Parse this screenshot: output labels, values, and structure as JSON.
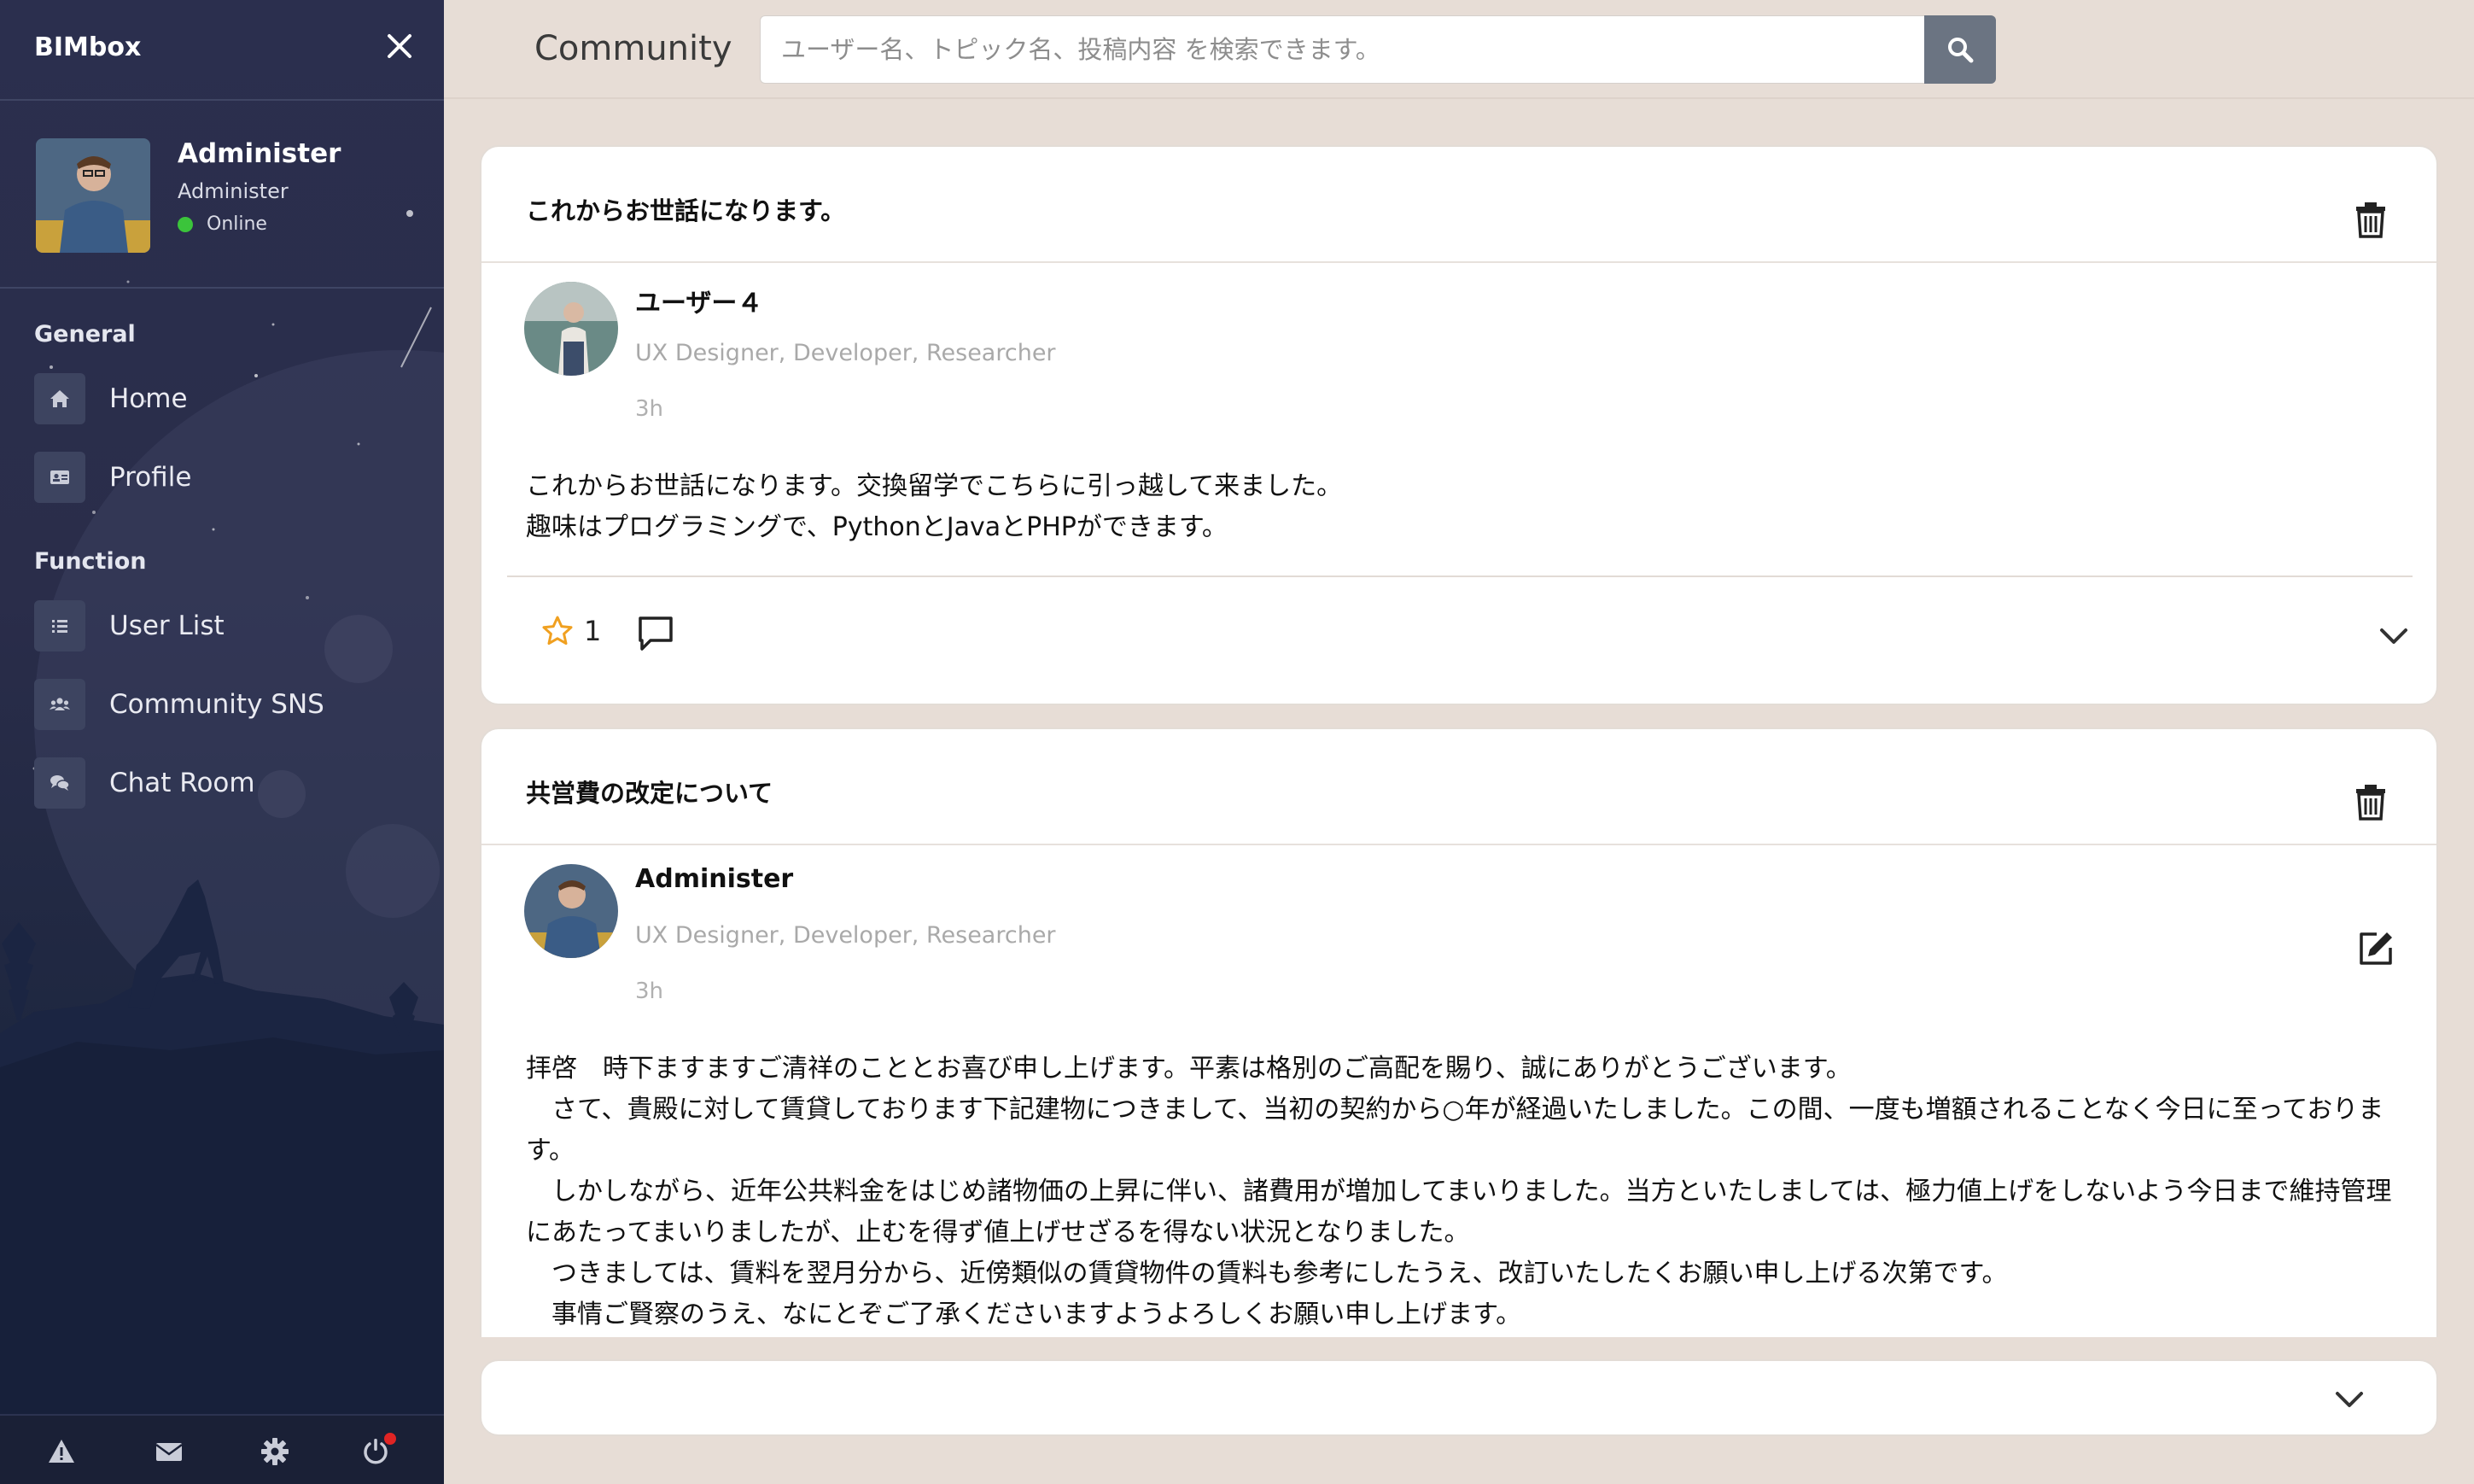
{
  "sidebar": {
    "brand": "BIMbox",
    "user": {
      "name": "Administer",
      "role": "Administer",
      "status": "Online"
    },
    "sections": [
      {
        "title": "General",
        "items": [
          {
            "label": "Home",
            "icon": "home-icon"
          },
          {
            "label": "Profile",
            "icon": "id-card-icon"
          }
        ]
      },
      {
        "title": "Function",
        "items": [
          {
            "label": "User List",
            "icon": "list-icon"
          },
          {
            "label": "Community SNS",
            "icon": "users-icon"
          },
          {
            "label": "Chat Room",
            "icon": "chat-bubbles-icon"
          }
        ]
      }
    ],
    "footer_icons": [
      "warning-icon",
      "envelope-icon",
      "gear-icon",
      "power-icon"
    ]
  },
  "header": {
    "title": "Community",
    "search_placeholder": "ユーザー名、トピック名、投稿内容 を検索できます。"
  },
  "posts": [
    {
      "title": "これからお世話になります。",
      "author": "ユーザー４",
      "role": "UX Designer, Developer, Researcher",
      "time": "3h",
      "body": "これからお世話になります。交換留学でこちらに引っ越して来ました。\n趣味はプログラミングで、PythonとJavaとPHPができます。",
      "stars": "1"
    },
    {
      "title": "共営費の改定について",
      "author": "Administer",
      "role": "UX Designer, Developer, Researcher",
      "time": "3h",
      "body": "拝啓　時下ますますご清祥のこととお喜び申し上げます。平素は格別のご高配を賜り、誠にありがとうございます。\n　さて、貴殿に対して賃貸しております下記建物につきまして、当初の契約から○年が経過いたしました。この間、一度も増額されることなく今日に至っております。\n　しかしながら、近年公共料金をはじめ諸物価の上昇に伴い、諸費用が増加してまいりました。当方といたしましては、極力値上げをしないよう今日まで維持管理にあたってまいりましたが、止むを得ず値上げせざるを得ない状況となりました。\n　つきましては、賃料を翌月分から、近傍類似の賃貸物件の賃料も参考にしたうえ、改訂いたしたくお願い申し上げる次第です。\n　事情ご賢察のうえ、なにとぞご了承くださいますようよろしくお願い申し上げます。"
    }
  ],
  "colors": {
    "sidebar_bg": "#2b2f4e",
    "page_bg": "#e7ddd6",
    "online": "#3bc43b",
    "star": "#f0a020",
    "search_button": "#6b7482"
  }
}
